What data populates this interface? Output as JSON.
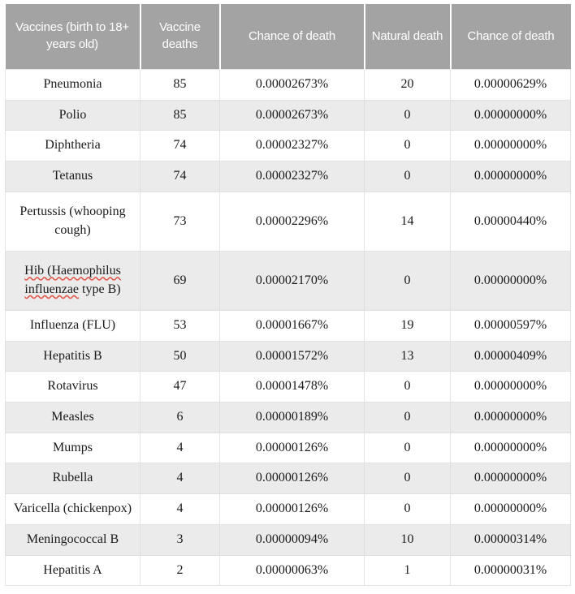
{
  "table": {
    "headers": [
      "Vaccines (birth to 18+ years old)",
      "Vaccine deaths",
      "Chance of death",
      "Natural death",
      "Chance of death"
    ],
    "rows": [
      {
        "vaccine": "Pneumonia",
        "vaccine_deaths": "85",
        "vaccine_chance": "0.00002673%",
        "natural_deaths": "20",
        "natural_chance": "0.00000629%"
      },
      {
        "vaccine": "Polio",
        "vaccine_deaths": "85",
        "vaccine_chance": "0.00002673%",
        "natural_deaths": "0",
        "natural_chance": "0.00000000%"
      },
      {
        "vaccine": "Diphtheria",
        "vaccine_deaths": "74",
        "vaccine_chance": "0.00002327%",
        "natural_deaths": "0",
        "natural_chance": "0.00000000%"
      },
      {
        "vaccine": "Tetanus",
        "vaccine_deaths": "74",
        "vaccine_chance": "0.00002327%",
        "natural_deaths": "0",
        "natural_chance": "0.00000000%"
      },
      {
        "vaccine": "Pertussis (whooping cough)",
        "vaccine_deaths": "73",
        "vaccine_chance": "0.00002296%",
        "natural_deaths": "14",
        "natural_chance": "0.00000440%"
      },
      {
        "vaccine": "Hib (Haemophilus influenzae type B)",
        "vaccine_deaths": "69",
        "vaccine_chance": "0.00002170%",
        "natural_deaths": "0",
        "natural_chance": "0.00000000%"
      },
      {
        "vaccine": "Influenza (FLU)",
        "vaccine_deaths": "53",
        "vaccine_chance": "0.00001667%",
        "natural_deaths": "19",
        "natural_chance": "0.00000597%"
      },
      {
        "vaccine": "Hepatitis B",
        "vaccine_deaths": "50",
        "vaccine_chance": "0.00001572%",
        "natural_deaths": "13",
        "natural_chance": "0.00000409%"
      },
      {
        "vaccine": "Rotavirus",
        "vaccine_deaths": "47",
        "vaccine_chance": "0.00001478%",
        "natural_deaths": "0",
        "natural_chance": "0.00000000%"
      },
      {
        "vaccine": "Measles",
        "vaccine_deaths": "6",
        "vaccine_chance": "0.00000189%",
        "natural_deaths": "0",
        "natural_chance": "0.00000000%"
      },
      {
        "vaccine": "Mumps",
        "vaccine_deaths": "4",
        "vaccine_chance": "0.00000126%",
        "natural_deaths": "0",
        "natural_chance": "0.00000000%"
      },
      {
        "vaccine": "Rubella",
        "vaccine_deaths": "4",
        "vaccine_chance": "0.00000126%",
        "natural_deaths": "0",
        "natural_chance": "0.00000000%"
      },
      {
        "vaccine": "Varicella (chickenpox)",
        "vaccine_deaths": "4",
        "vaccine_chance": "0.00000126%",
        "natural_deaths": "0",
        "natural_chance": "0.00000000%"
      },
      {
        "vaccine": "Meningococcal B",
        "vaccine_deaths": "3",
        "vaccine_chance": "0.00000094%",
        "natural_deaths": "10",
        "natural_chance": "0.00000314%"
      },
      {
        "vaccine": "Hepatitis A",
        "vaccine_deaths": "2",
        "vaccine_chance": "0.00000063%",
        "natural_deaths": "1",
        "natural_chance": "0.00000031%"
      }
    ],
    "spellcheck_row_index": 5,
    "spellcheck_terms": [
      "Hib (Haemophilus",
      "influenzae"
    ],
    "colors": {
      "header_background": "#a3a3a3",
      "header_text": "#ffffff",
      "shaded_row_background": "#ebebeb",
      "plain_row_background": "#ffffff",
      "cell_border": "#e3e3e3",
      "body_text": "#1a1a1a",
      "spellcheck_underline": "#e2574c"
    }
  }
}
